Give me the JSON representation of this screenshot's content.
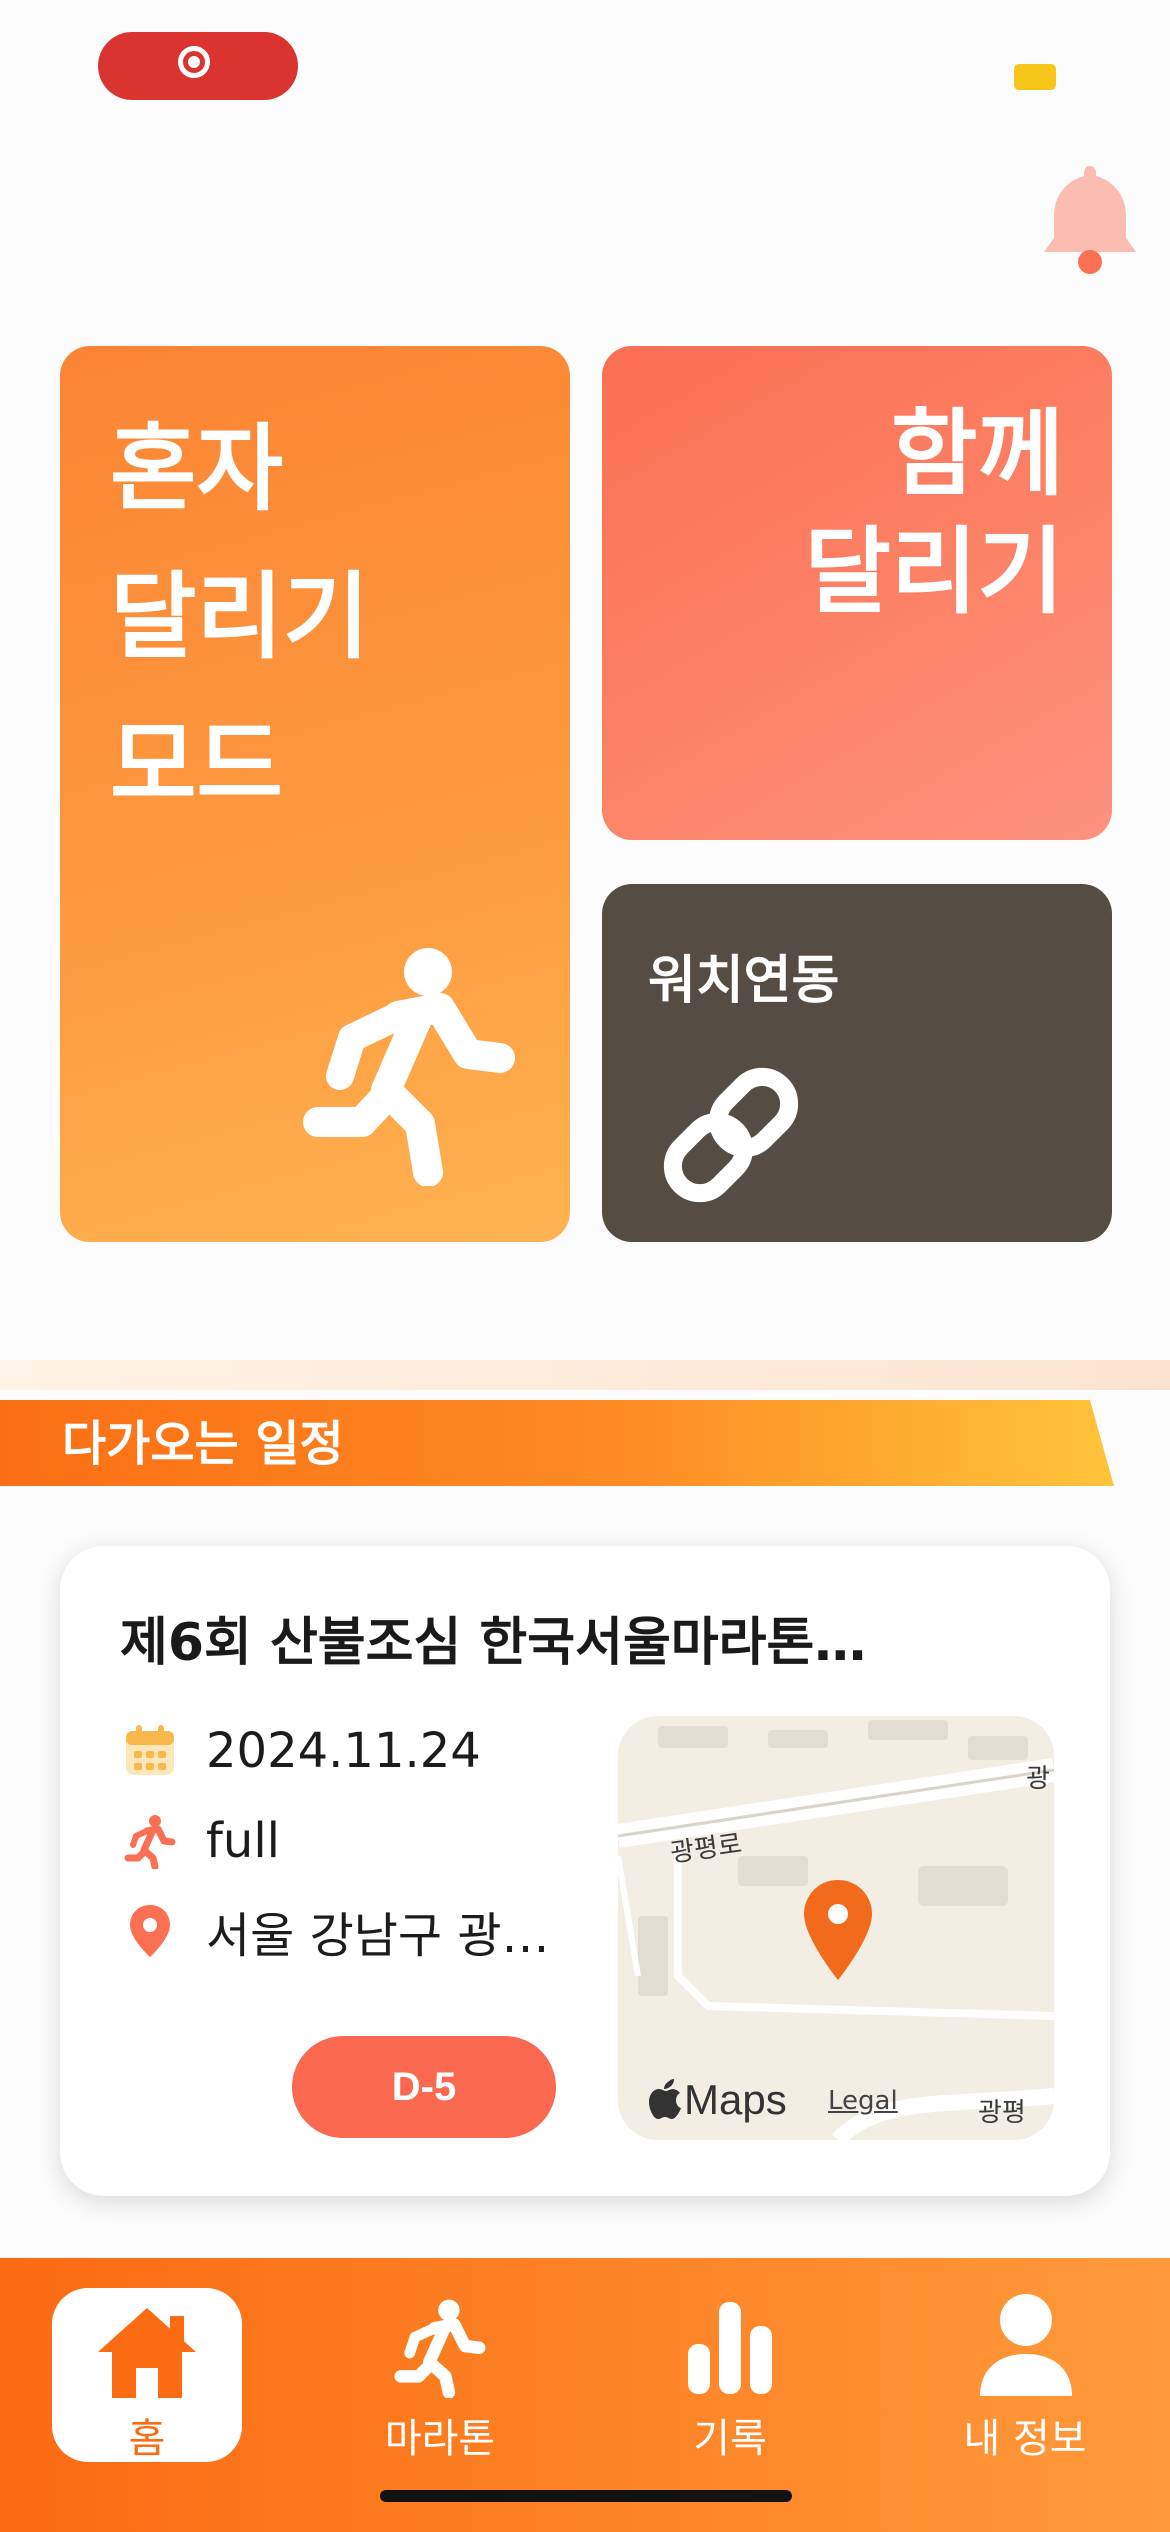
{
  "status_bar": {
    "recording_icon": "screen-record-icon",
    "battery_icon": "battery-icon",
    "battery_color": "#f7c61a"
  },
  "header": {
    "bell_icon": "bell-icon"
  },
  "tiles": {
    "solo": {
      "label": "혼자\n달리기\n모드",
      "icon": "running-person-icon"
    },
    "together": {
      "label": "함께\n달리기"
    },
    "watch": {
      "label": "워치연동",
      "icon": "link-icon"
    }
  },
  "section": {
    "title": "다가오는 일정"
  },
  "event": {
    "title": "제6회 산불조심 한국서울마라톤…",
    "date": "2024.11.24",
    "course": "full",
    "location": "서울 강남구 광…",
    "dday": "D-5",
    "map": {
      "road_labels": [
        "광평로",
        "광",
        "광평"
      ],
      "brand": "Maps",
      "legal": "Legal"
    }
  },
  "nav": {
    "items": [
      {
        "label": "홈",
        "icon": "home-icon",
        "active": true
      },
      {
        "label": "마라톤",
        "icon": "running-person-icon",
        "active": false
      },
      {
        "label": "기록",
        "icon": "bar-chart-icon",
        "active": false
      },
      {
        "label": "내 정보",
        "icon": "user-icon",
        "active": false
      }
    ]
  },
  "colors": {
    "primary_orange": "#fb8434",
    "coral": "#fb6f53",
    "dark": "#554d44",
    "dday": "#f9684f"
  }
}
